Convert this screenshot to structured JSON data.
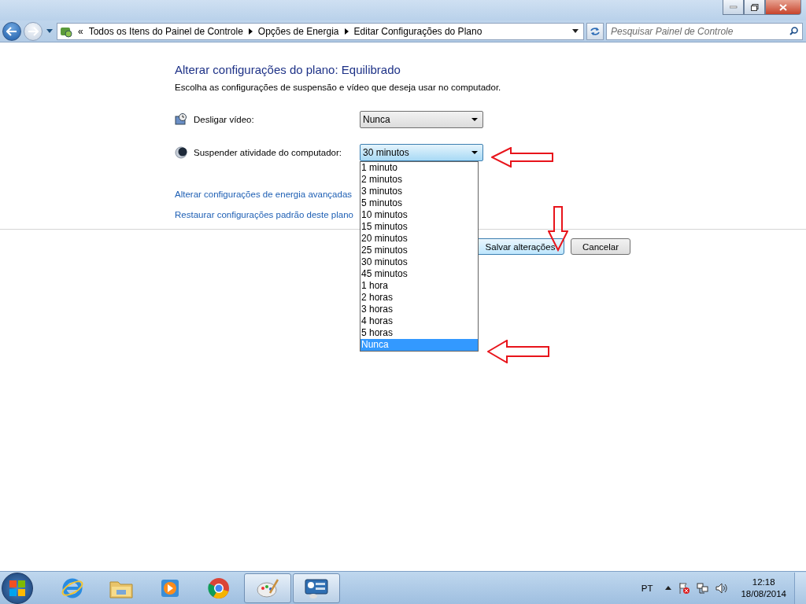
{
  "address_bar": {
    "breadcrumbs": [
      "Todos os Itens do Painel de Controle",
      "Opções de Energia",
      "Editar Configurações do Plano"
    ],
    "overflow": "«",
    "search": {
      "placeholder": "Pesquisar Painel de Controle"
    }
  },
  "heading": "Alterar configurações do plano: Equilibrado",
  "description": "Escolha as configurações de suspensão e vídeo que deseja usar no computador.",
  "settings": [
    {
      "kind": "display",
      "label": "Desligar vídeo:",
      "value": "Nunca",
      "expanded": false
    },
    {
      "kind": "sleep",
      "label": "Suspender atividade do computador:",
      "value": "30 minutos",
      "expanded": true
    }
  ],
  "dropdown_options": [
    {
      "label": "1 minuto",
      "selected": false
    },
    {
      "label": "2 minutos",
      "selected": false
    },
    {
      "label": "3 minutos",
      "selected": false
    },
    {
      "label": "5 minutos",
      "selected": false
    },
    {
      "label": "10 minutos",
      "selected": false
    },
    {
      "label": "15 minutos",
      "selected": false
    },
    {
      "label": "20 minutos",
      "selected": false
    },
    {
      "label": "25 minutos",
      "selected": false
    },
    {
      "label": "30 minutos",
      "selected": false
    },
    {
      "label": "45 minutos",
      "selected": false
    },
    {
      "label": "1 hora",
      "selected": false
    },
    {
      "label": "2 horas",
      "selected": false
    },
    {
      "label": "3 horas",
      "selected": false
    },
    {
      "label": "4 horas",
      "selected": false
    },
    {
      "label": "5 horas",
      "selected": false
    },
    {
      "label": "Nunca",
      "selected": true
    }
  ],
  "links": [
    "Alterar configurações de energia avançadas",
    "Restaurar configurações padrão deste plano"
  ],
  "buttons": [
    "Salvar alterações",
    "Cancelar"
  ],
  "taskbar": {
    "apps": [
      {
        "kind": "ie",
        "active": false
      },
      {
        "kind": "explorer",
        "active": false
      },
      {
        "kind": "media",
        "active": false
      },
      {
        "kind": "chrome",
        "active": false
      },
      {
        "kind": "paint",
        "active": true
      },
      {
        "kind": "control",
        "active": true
      }
    ],
    "language": "PT",
    "time": "12:18",
    "date": "18/08/2014"
  }
}
